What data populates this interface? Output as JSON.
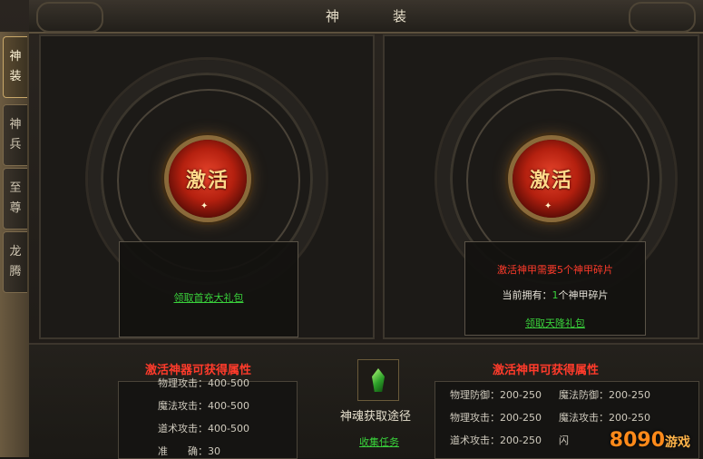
{
  "window": {
    "title": "神　装"
  },
  "tabs": [
    {
      "label": "神\n装",
      "active": true
    },
    {
      "label": "神\n兵",
      "active": false
    },
    {
      "label": "至\n尊",
      "active": false
    },
    {
      "label": "龙\n腾",
      "active": false
    }
  ],
  "left_panel": {
    "emblem_label": "激活",
    "link": "领取首充大礼包"
  },
  "right_panel": {
    "emblem_label": "激活",
    "requirement": "激活神甲需要5个神甲碎片",
    "owned_prefix": "当前拥有：",
    "owned_count": "1",
    "owned_suffix": "个神甲碎片",
    "link": "领取天降礼包"
  },
  "bottom": {
    "left_header": "激活神器可获得属性",
    "left_stats": [
      "物理攻击：400-500",
      "魔法攻击：400-500",
      "道术攻击：400-500",
      "准　　确：30"
    ],
    "center_title": "神魂获取途径",
    "center_link": "收集任务",
    "right_header": "激活神甲可获得属性",
    "right_stats": [
      [
        "物理防御：200-250",
        "魔法防御：200-250"
      ],
      [
        "物理攻击：200-250",
        "魔法攻击：200-250"
      ],
      [
        "道术攻击：200-250",
        "闪"
      ]
    ]
  },
  "watermark": {
    "main": "8090",
    "sub": "游戏"
  },
  "colors": {
    "accent_red": "#ff3b2b",
    "link_green": "#39d13b",
    "frame": "#3c362d"
  }
}
